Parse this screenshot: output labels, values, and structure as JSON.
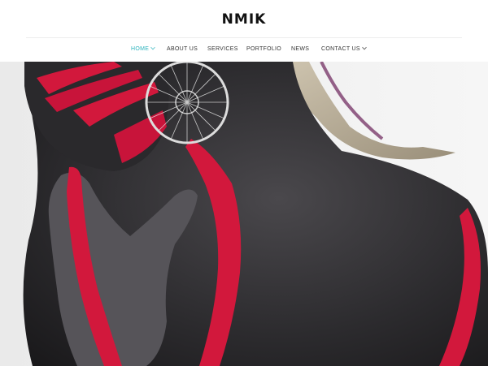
{
  "brand": {
    "logo_text": "NMIK"
  },
  "nav": {
    "items": [
      {
        "label": "HOME",
        "active": true,
        "has_dropdown": true
      },
      {
        "label": "ABOUT US",
        "active": false,
        "has_dropdown": false
      },
      {
        "label": "SERVICES",
        "active": false,
        "has_dropdown": false
      },
      {
        "label": "PORTFOLIO",
        "active": false,
        "has_dropdown": false
      },
      {
        "label": "NEWS",
        "active": false,
        "has_dropdown": false
      },
      {
        "label": "CONTACT US",
        "active": false,
        "has_dropdown": true
      }
    ]
  },
  "colors": {
    "accent": "#2bb3bd",
    "text": "#333333",
    "hero_skin": "#2e2d30",
    "hero_paint": "#d2183c",
    "hero_background": "#f2f2f2"
  }
}
